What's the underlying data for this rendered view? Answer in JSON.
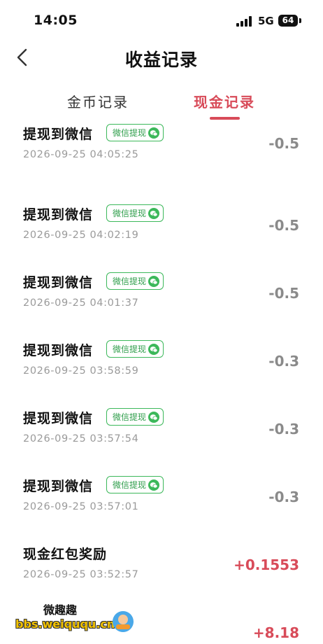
{
  "status_bar": {
    "time": "14:05",
    "network": "5G",
    "battery": "64"
  },
  "nav": {
    "title": "收益记录"
  },
  "tabs": [
    {
      "label": "金币记录",
      "active": false
    },
    {
      "label": "现金记录",
      "active": true
    }
  ],
  "records": [
    {
      "title": "提现到微信",
      "badge": "微信提现",
      "time": "2026-09-25 04:05:25",
      "amount": "-0.5"
    },
    {
      "title": "提现到微信",
      "badge": "微信提现",
      "time": "2026-09-25 04:02:19",
      "amount": "-0.5"
    },
    {
      "title": "提现到微信",
      "badge": "微信提现",
      "time": "2026-09-25 04:01:37",
      "amount": "-0.5"
    },
    {
      "title": "提现到微信",
      "badge": "微信提现",
      "time": "2026-09-25 03:58:59",
      "amount": "-0.3"
    },
    {
      "title": "提现到微信",
      "badge": "微信提现",
      "time": "2026-09-25 03:57:54",
      "amount": "-0.3"
    },
    {
      "title": "提现到微信",
      "badge": "微信提现",
      "time": "2026-09-25 03:57:01",
      "amount": "-0.3"
    },
    {
      "title": "现金红包奖励",
      "badge": "",
      "time": "2026-09-25 03:52:57",
      "amount": "+0.1553"
    },
    {
      "title": "",
      "badge": "",
      "time": "",
      "amount": "+8.18"
    }
  ],
  "watermark": {
    "top": "微趣趣",
    "url": "bbs.weiququ.cn"
  },
  "colors": {
    "accent": "#d84b59",
    "wechat_green": "#3cb85a",
    "muted": "#9a9a9a"
  }
}
